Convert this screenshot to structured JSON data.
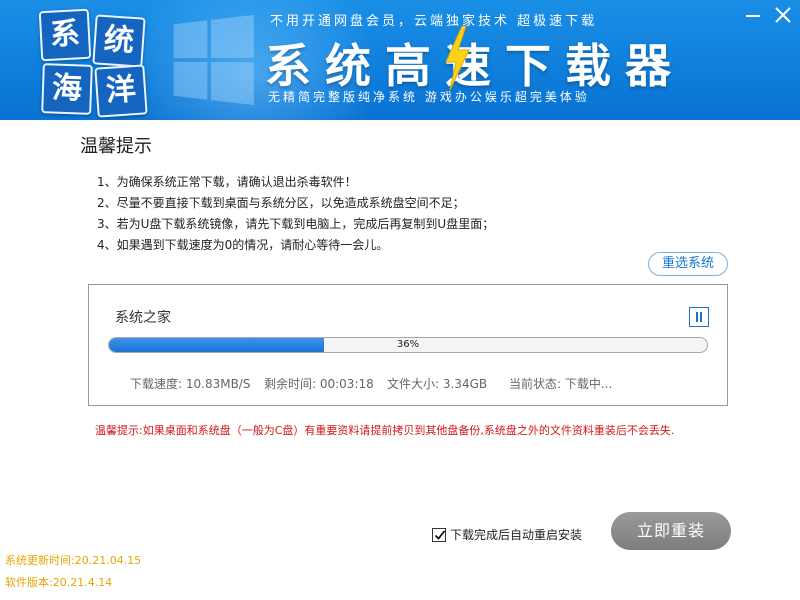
{
  "header": {
    "logo_chars": [
      "系",
      "统",
      "海",
      "洋"
    ],
    "tagline_top": "不用开通网盘会员，云端独家技术 超极速下载",
    "title": "系统高速下载器",
    "tagline_bottom": "无精简完整版纯净系统 游戏办公娱乐超完美体验",
    "colors": {
      "header_bg": "#0f7fdc",
      "bolt": "#ffd21a"
    }
  },
  "tips": {
    "title": "温馨提示",
    "items": [
      "1、为确保系统正常下载，请确认退出杀毒软件！",
      "2、尽量不要直接下载到桌面与系统分区，以免造成系统盘空间不足；",
      "3、若为U盘下载系统镜像，请先下载到电脑上，完成后再复制到U盘里面；",
      "4、如果遇到下载速度为0的情况，请耐心等待一会儿。"
    ]
  },
  "reselect_label": "重选系统",
  "download": {
    "name": "系统之家",
    "progress_percent": 36,
    "progress_label": "36%",
    "speed": "下载速度: 10.83MB/S",
    "remaining": "剩余时间: 00:03:18",
    "size": "文件大小: 3.34GB",
    "status": "当前状态: 下载中..."
  },
  "warning": "温馨提示:如果桌面和系统盘（一般为C盘）有重要资料请提前拷贝到其他盘备份,系统盘之外的文件资料重装后不会丢失.",
  "auto_restart": {
    "label": "下载完成后自动重启安装",
    "checked": true
  },
  "reinstall_label": "立即重装",
  "version": {
    "updated": "系统更新时间:20.21.04.15",
    "software": "软件版本:20.21.4.14"
  }
}
